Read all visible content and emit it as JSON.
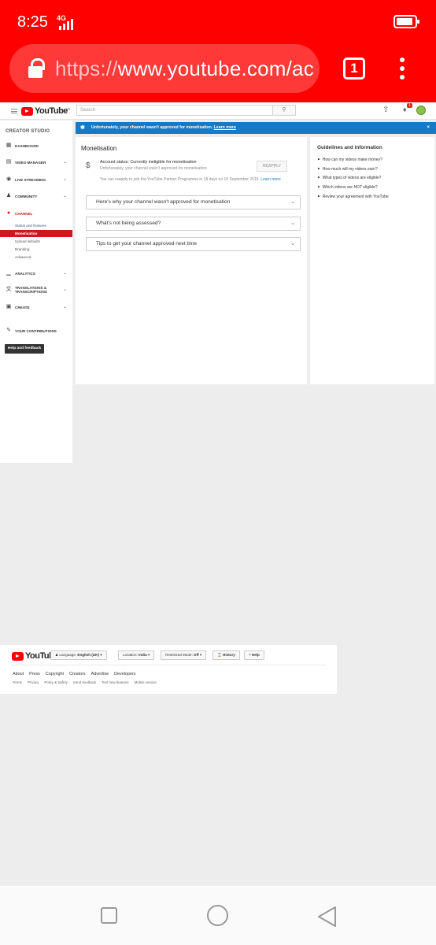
{
  "status_bar": {
    "time": "8:25",
    "network": "4G"
  },
  "browser": {
    "url_scheme": "https://",
    "url_rest": "www.youtube.com/ac",
    "tab_count": "1"
  },
  "masthead": {
    "search_placeholder": "Search",
    "notification_count": "1",
    "logo_text": "YouTube",
    "logo_region": "IN"
  },
  "sidebar": {
    "title": "CREATOR STUDIO",
    "items": [
      {
        "label": "DASHBOARD",
        "icon": "dashboard-icon"
      },
      {
        "label": "VIDEO MANAGER",
        "icon": "video-manager-icon"
      },
      {
        "label": "LIVE STREAMING",
        "icon": "live-streaming-icon"
      },
      {
        "label": "COMMUNITY",
        "icon": "community-icon"
      },
      {
        "label": "CHANNEL",
        "icon": "channel-icon"
      },
      {
        "label": "ANALYTICS",
        "icon": "analytics-icon"
      },
      {
        "label": "TRANSLATIONS & TRANSCRIPTIONS",
        "icon": "translations-icon"
      },
      {
        "label": "CREATE",
        "icon": "create-icon"
      },
      {
        "label": "YOUR CONTRIBUTIONS",
        "icon": "contributions-icon"
      }
    ],
    "channel_subitems": [
      "Status and features",
      "Monetisation",
      "Upload defaults",
      "Branding",
      "Advanced"
    ],
    "help_button": "Help and feedback"
  },
  "banner": {
    "message": "Unfortunately, your channel wasn't approved for monetisation.",
    "link": "Learn more"
  },
  "monetisation": {
    "title": "Monetisation",
    "account_status": "Account status: Currently ineligible for monetisation",
    "account_detail": "Unfortunately, your channel wasn't approved for monetisation.",
    "reapply_button": "REAPPLY",
    "reapply_note": "You can reapply to join the YouTube Partner Programme in 18 days on 19 September 2019.",
    "reapply_link": "Learn more",
    "accordions": [
      "Here's why your channel wasn't approved for monetisation",
      "What's not being assessed?",
      "Tips to get your channel approved next time"
    ]
  },
  "guidelines": {
    "title": "Guidelines and information",
    "items": [
      "How can my videos make money?",
      "How much will my videos earn?",
      "What types of videos are eligible?",
      "Which videos are NOT eligible?",
      "Review your agreement with YouTube"
    ]
  },
  "footer": {
    "language_label": "Language:",
    "language_value": "English (UK)",
    "location_label": "Location:",
    "location_value": "India",
    "restricted_label": "Restricted Mode:",
    "restricted_value": "Off",
    "history": "History",
    "help": "Help",
    "links_primary": [
      "About",
      "Press",
      "Copyright",
      "Creators",
      "Advertise",
      "Developers"
    ],
    "links_secondary": [
      "Terms",
      "Privacy",
      "Policy & Safety",
      "Send feedback",
      "Test new features",
      "Mobile version"
    ]
  },
  "colors": {
    "brand_red": "#ff0000",
    "studio_red": "#cc181e",
    "banner_blue": "#167ac6"
  }
}
